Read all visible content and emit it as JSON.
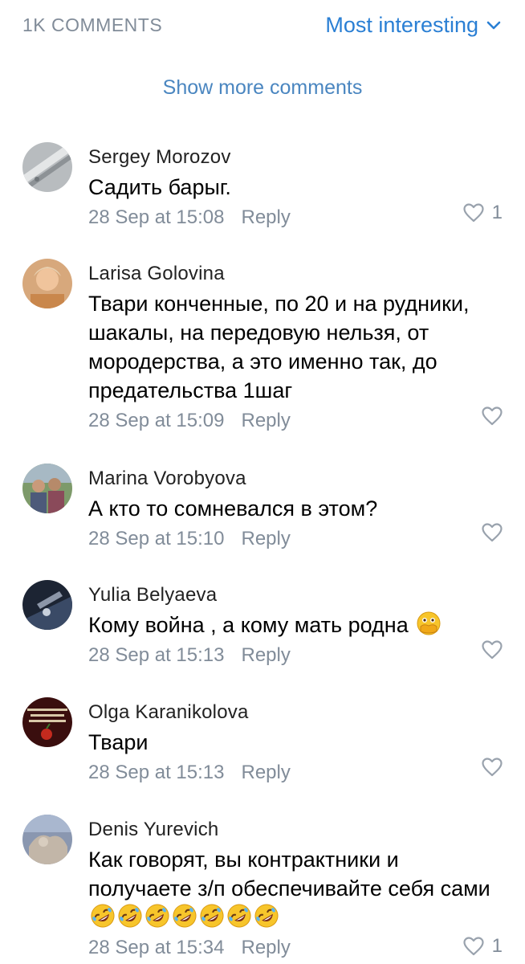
{
  "header": {
    "count_label": "1K COMMENTS",
    "sort_label": "Most interesting"
  },
  "show_more_label": "Show more comments",
  "reply_label": "Reply",
  "comments": [
    {
      "author": "Sergey Morozov",
      "text": "Садить барыг.",
      "time": "28 Sep at 15:08",
      "likes": "1"
    },
    {
      "author": "Larisa Golovina",
      "text": "Твари конченные, по 20 и на рудники, шакалы, на передовую нельзя, от мородерства, а это именно так, до предательства 1шаг",
      "time": "28 Sep at 15:09",
      "likes": ""
    },
    {
      "author": "Marina Vorobyova",
      "text": "А кто то сомневался в этом?",
      "time": "28 Sep at 15:10",
      "likes": ""
    },
    {
      "author": "Yulia Belyaeva",
      "text": "Кому война , а кому мать родна",
      "emoji": "face-with-hand-over-mouth",
      "time": "28 Sep at 15:13",
      "likes": ""
    },
    {
      "author": "Olga Karanikolova",
      "text": "Твари",
      "time": "28 Sep at 15:13",
      "likes": ""
    },
    {
      "author": "Denis Yurevich",
      "text": "Как говорят, вы контрактники и получаете з/п обеспечивайте себя сами",
      "emoji": "rolling-on-the-floor-laughing x7",
      "time": "28 Sep at 15:34",
      "likes": "1"
    }
  ],
  "colors": {
    "accent": "#2a7fd4",
    "secondary_text": "#818c99",
    "link": "#4a86c0"
  }
}
